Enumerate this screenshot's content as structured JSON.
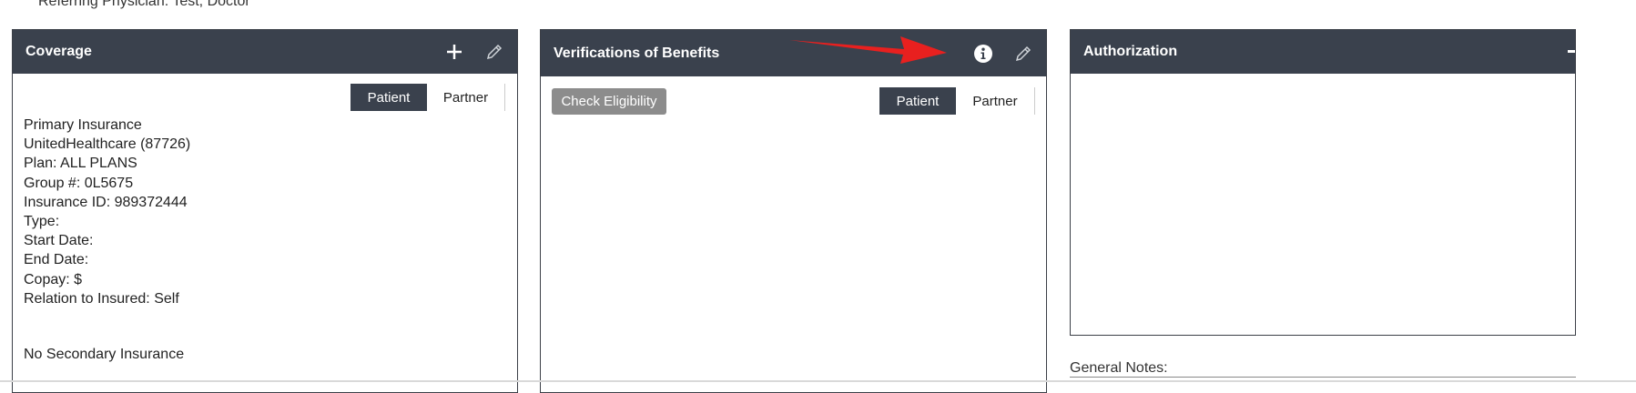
{
  "header": {
    "referring_physician": "Referring Physician: Test, Doctor"
  },
  "coverage": {
    "title": "Coverage",
    "toggle": {
      "patient": "Patient",
      "partner": "Partner",
      "active": "Patient"
    },
    "primary": [
      "Primary Insurance",
      "UnitedHealthcare (87726)",
      "Plan: ALL PLANS",
      "Group #: 0L5675",
      "Insurance ID: 989372444",
      "Type:",
      "Start Date:",
      "End Date:",
      "Copay: $",
      "Relation to Insured: Self"
    ],
    "secondary": "No Secondary Insurance"
  },
  "verifications": {
    "title": "Verifications of Benefits",
    "check_eligibility": "Check Eligibility",
    "toggle": {
      "patient": "Patient",
      "partner": "Partner",
      "active": "Patient"
    }
  },
  "authorization": {
    "title": "Authorization"
  },
  "general_notes": {
    "label": "General Notes:"
  },
  "icons": {
    "add": "plus-icon",
    "edit": "pencil-icon",
    "info": "info-icon",
    "collapse": "minus-icon",
    "annotation": "red-arrow"
  },
  "colors": {
    "header_bg": "#3a414d",
    "toggle_active": "#3a414d",
    "button_gray": "#8c8c8c",
    "arrow_red": "#e8201f"
  }
}
